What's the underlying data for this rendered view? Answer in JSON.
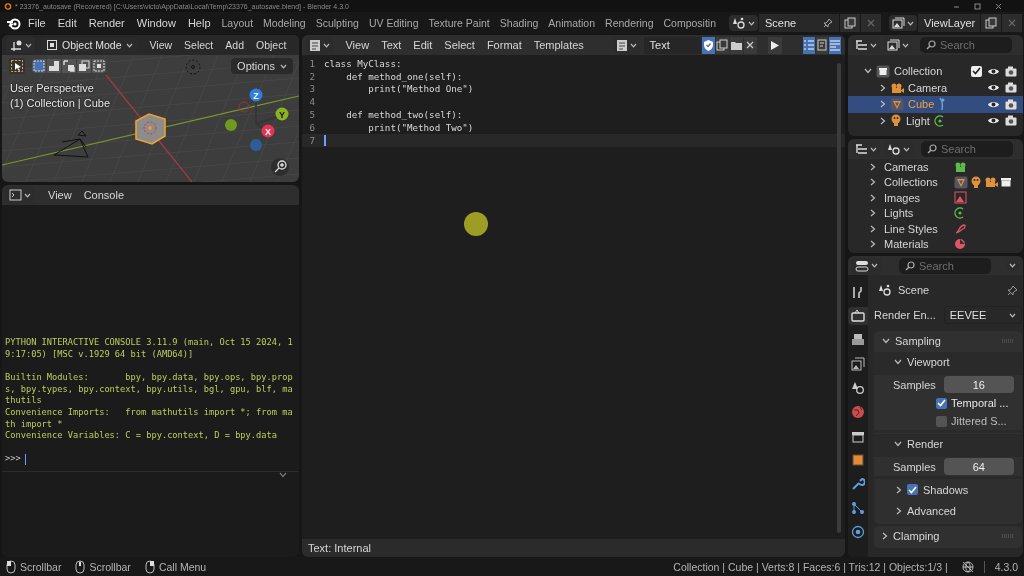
{
  "title_bar": {
    "text": "* 23376_autosave (Recovered) [C:\\Users\\victo\\AppData\\Local\\Temp\\23376_autosave.blend] - Blender 4.3.0"
  },
  "top_bar": {
    "menus": [
      "File",
      "Edit",
      "Render",
      "Window",
      "Help"
    ],
    "workspaces": [
      {
        "label": "Layout",
        "selected": false
      },
      {
        "label": "Modeling",
        "selected": false
      },
      {
        "label": "Sculpting",
        "selected": false
      },
      {
        "label": "UV Editing",
        "selected": false
      },
      {
        "label": "Texture Paint",
        "selected": false
      },
      {
        "label": "Shading",
        "selected": false
      },
      {
        "label": "Animation",
        "selected": false
      },
      {
        "label": "Rendering",
        "selected": false
      },
      {
        "label": "Compositin",
        "selected": false
      }
    ],
    "scene": "Scene",
    "view_layer": "ViewLayer"
  },
  "viewport": {
    "mode": "Object Mode",
    "menus": [
      "View",
      "Select",
      "Add",
      "Object"
    ],
    "options": "Options",
    "info": [
      "User Perspective",
      "(1) Collection | Cube"
    ],
    "gizmo_labels": {
      "x": "X",
      "y": "Y",
      "z": "Z"
    }
  },
  "console": {
    "menus": [
      "View",
      "Console"
    ],
    "blocks": [
      [
        "PYTHON INTERACTIVE CONSOLE 3.11.9 (main, Oct 15 2024, 1",
        "9:17:05) [MSC v.1929 64 bit (AMD64)]"
      ],
      [
        "Builtin Modules:       bpy, bpy.data, bpy.ops, bpy.prop",
        "s, bpy.types, bpy.context, bpy.utils, bgl, gpu, blf, ma",
        "thutils",
        "Convenience Imports:   from mathutils import *; from ma",
        "th import *",
        "Convenience Variables: C = bpy.context, D = bpy.data"
      ]
    ],
    "prompt": ">>>"
  },
  "text_editor": {
    "menus": [
      "View",
      "Text",
      "Edit",
      "Select",
      "Format",
      "Templates"
    ],
    "datablock": "Text",
    "trusted": true,
    "view_toggles": [
      {
        "kind": "line_numbers",
        "on": true
      },
      {
        "kind": "word_wrap",
        "on": false
      },
      {
        "kind": "syntax",
        "on": true
      }
    ],
    "lines": [
      {
        "number": "1",
        "code": "class MyClass:",
        "current": false
      },
      {
        "number": "2",
        "code": "    def method_one(self):",
        "current": false
      },
      {
        "number": "3",
        "code": "        print(\"Method One\")",
        "current": false
      },
      {
        "number": "4",
        "current": false
      },
      {
        "number": "5",
        "code": "    def method_two(self):",
        "current": false
      },
      {
        "number": "6",
        "code": "        print(\"Method Two\")",
        "current": false
      },
      {
        "number": "7",
        "current": true
      }
    ],
    "footer": "Text: Internal"
  },
  "outliner": {
    "search_placeholder": "Search",
    "tree": [
      {
        "label": "Collection",
        "kind": "collection",
        "expanded": true,
        "checked": true,
        "selected": false,
        "children": [
          {
            "label": "Camera",
            "kind": "camera",
            "expanded": false,
            "selected": false
          },
          {
            "label": "Cube",
            "kind": "mesh",
            "expanded": false,
            "selected": true
          },
          {
            "label": "Light",
            "kind": "light",
            "expanded": false,
            "selected": false
          }
        ]
      }
    ]
  },
  "blend_file": {
    "search_placeholder": "Search",
    "items": [
      {
        "label": "Cameras",
        "kind": "cameras"
      },
      {
        "label": "Collections",
        "kind": "collections"
      },
      {
        "label": "Images",
        "kind": "images"
      },
      {
        "label": "Lights",
        "kind": "lights"
      },
      {
        "label": "Line Styles",
        "kind": "line_styles"
      },
      {
        "label": "Materials",
        "kind": "materials"
      }
    ]
  },
  "properties": {
    "search_placeholder": "Search",
    "tabs": [
      {
        "kind": "tool",
        "selected": false
      },
      {
        "kind": "render",
        "selected": true
      },
      {
        "kind": "output",
        "selected": false
      },
      {
        "kind": "view_layer",
        "selected": false
      },
      {
        "kind": "scene",
        "selected": false
      },
      {
        "kind": "world",
        "selected": false
      },
      {
        "kind": "collection",
        "selected": false
      },
      {
        "kind": "object",
        "selected": false
      },
      {
        "kind": "modifiers",
        "selected": false
      },
      {
        "kind": "particles",
        "selected": false
      },
      {
        "kind": "physics",
        "selected": false
      }
    ],
    "context": "Scene",
    "render_engine": {
      "label": "Render En...",
      "value": "EEVEE"
    },
    "panels": [
      {
        "title": "Sampling",
        "expanded": true,
        "subpanels": [
          {
            "title": "Viewport",
            "expanded": true,
            "rows": [
              {
                "kind": "number",
                "label": "Samples",
                "value": "16"
              },
              {
                "kind": "checkbox",
                "label": "Temporal ...",
                "checked": true
              },
              {
                "kind": "checkbox",
                "label": "Jittered S...",
                "checked": false
              }
            ]
          },
          {
            "title": "Render",
            "expanded": true,
            "rows": [
              {
                "kind": "number",
                "label": "Samples",
                "value": "64"
              }
            ],
            "subpanels": [
              {
                "title": "Shadows",
                "expanded": false,
                "checked": true
              },
              {
                "title": "Advanced",
                "expanded": false
              }
            ]
          }
        ]
      },
      {
        "title": "Clamping",
        "expanded": false
      }
    ]
  },
  "status_bar": {
    "hints": [
      {
        "kind": "left_click",
        "label": "Scrollbar"
      },
      {
        "kind": "middle_click",
        "label": "Scrollbar"
      },
      {
        "kind": "right_click",
        "label": "Call Menu"
      }
    ],
    "stats": "Collection | Cube | Verts:8 | Faces:6 | Tris:12 | Objects:1/3 |",
    "version": "4.3.0"
  }
}
